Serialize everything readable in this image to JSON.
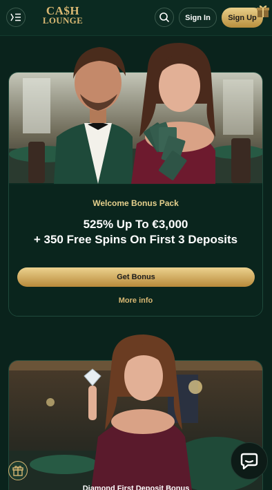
{
  "header": {
    "logo_line1": "CA$H",
    "logo_line2": "LOUNGE",
    "signin_label": "Sign In",
    "signup_label": "Sign Up"
  },
  "welcome_card": {
    "title": "Welcome Bonus Pack",
    "offer_line1": "525% Up To €3,000",
    "offer_line2": "+ 350 Free Spins On First 3 Deposits",
    "button_label": "Get Bonus",
    "link_label": "More info"
  },
  "diamond_card": {
    "title": "Diamond First Deposit Bonus"
  },
  "colors": {
    "background": "#0a231c",
    "gold": "#d9b873",
    "accent_title": "#e5d08d"
  },
  "icons": {
    "menu": "menu-icon",
    "search": "search-icon",
    "gift": "gift-icon",
    "chat": "chat-icon"
  }
}
